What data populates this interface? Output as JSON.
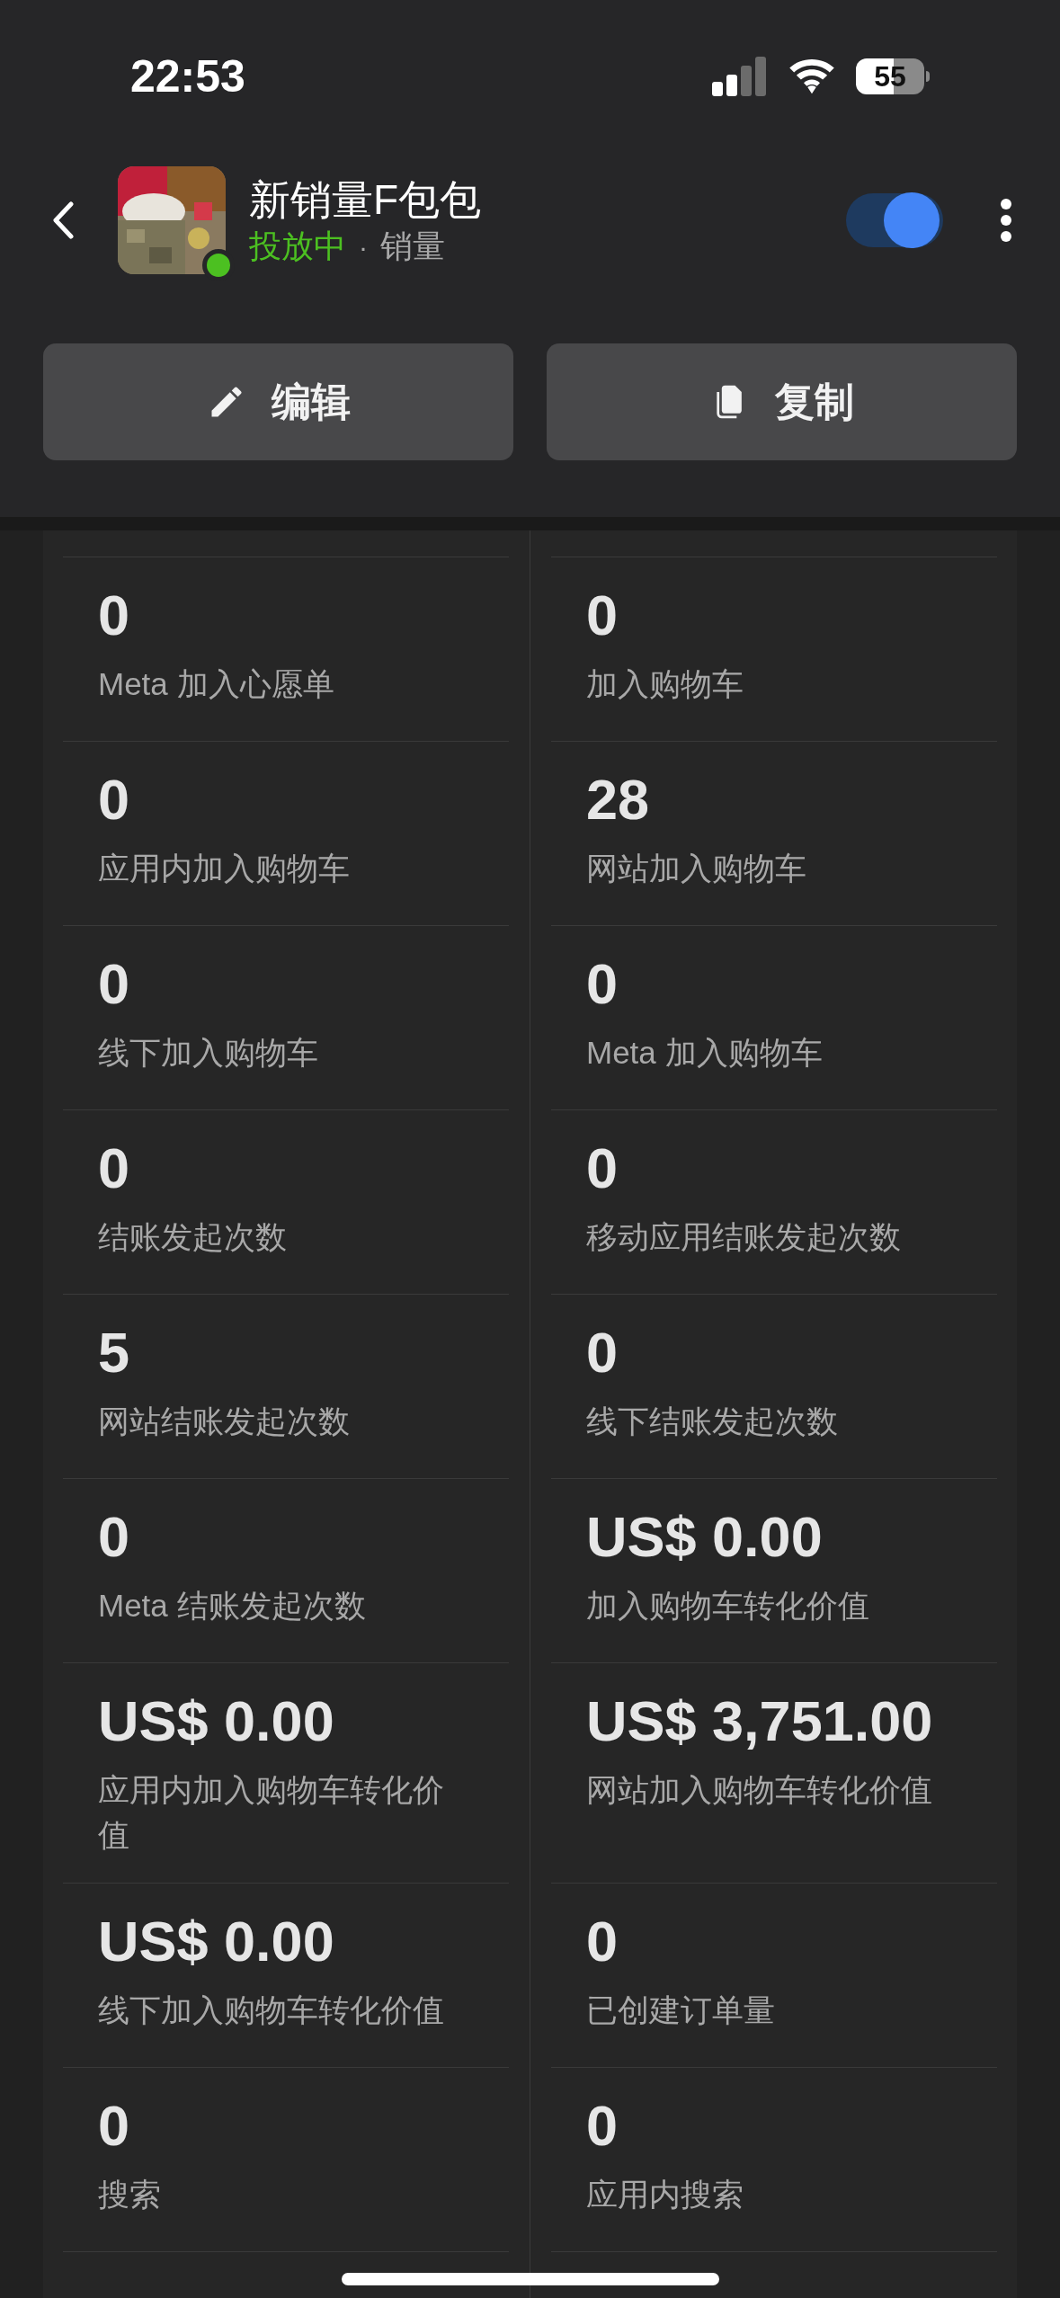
{
  "status_bar": {
    "time": "22:53",
    "battery": "55"
  },
  "header": {
    "title": "新销量F包包",
    "status": "投放中",
    "separator": "·",
    "objective": "销量",
    "active": {
      "on": true
    }
  },
  "buttons": [
    {
      "kind": "edit",
      "label": "编辑"
    },
    {
      "kind": "copy",
      "label": "复制"
    }
  ],
  "metrics": [
    {
      "value": "0",
      "label": "Meta 加入心愿单"
    },
    {
      "value": "0",
      "label": "加入购物车"
    },
    {
      "value": "0",
      "label": "应用内加入购物车"
    },
    {
      "value": "28",
      "label": "网站加入购物车"
    },
    {
      "value": "0",
      "label": "线下加入购物车"
    },
    {
      "value": "0",
      "label": "Meta 加入购物车"
    },
    {
      "value": "0",
      "label": "结账发起次数"
    },
    {
      "value": "0",
      "label": "移动应用结账发起次数"
    },
    {
      "value": "5",
      "label": "网站结账发起次数"
    },
    {
      "value": "0",
      "label": "线下结账发起次数"
    },
    {
      "value": "0",
      "label": "Meta 结账发起次数"
    },
    {
      "value": "US$ 0.00",
      "label": "加入购物车转化价值"
    },
    {
      "value": "US$ 0.00",
      "label": "应用内加入购物车转化价值"
    },
    {
      "value": "US$ 3,751.00",
      "label": "网站加入购物车转化价值"
    },
    {
      "value": "US$ 0.00",
      "label": "线下加入购物车转化价值"
    },
    {
      "value": "0",
      "label": "已创建订单量"
    },
    {
      "value": "0",
      "label": "搜索"
    },
    {
      "value": "0",
      "label": "应用内搜索"
    }
  ]
}
